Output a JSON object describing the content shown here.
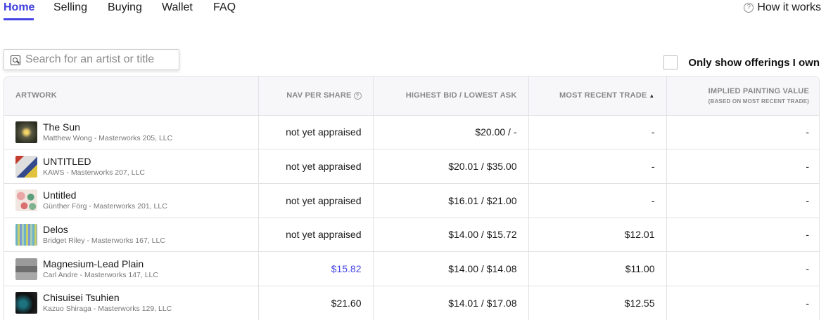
{
  "nav": {
    "tabs": [
      {
        "label": "Home",
        "active": true
      },
      {
        "label": "Selling",
        "active": false
      },
      {
        "label": "Buying",
        "active": false
      },
      {
        "label": "Wallet",
        "active": false
      },
      {
        "label": "FAQ",
        "active": false
      }
    ],
    "help_link": "How it works",
    "help_icon": "?"
  },
  "search": {
    "placeholder": "Search for an artist or title",
    "value": ""
  },
  "filter": {
    "only_show_label": "Only show offerings I own",
    "checked": false
  },
  "table": {
    "headers": {
      "artwork": "ARTWORK",
      "nav_per_share": "NAV PER SHARE",
      "nav_info_icon": "?",
      "bid_ask": "HIGHEST BID / LOWEST ASK",
      "most_recent_trade": "MOST RECENT TRADE",
      "sort_indicator": "▲",
      "implied_value": "IMPLIED PAINTING VALUE",
      "implied_value_sub": "(BASED ON MOST RECENT TRADE)"
    },
    "rows": [
      {
        "title": "The Sun",
        "subtitle": "Matthew Wong - Masterworks 205, LLC",
        "nav": "not yet appraised",
        "bid_ask": "$20.00 / -",
        "recent_trade": "-",
        "implied_value": "-"
      },
      {
        "title": "UNTITLED",
        "subtitle": "KAWS - Masterworks 207, LLC",
        "nav": "not yet appraised",
        "bid_ask": "$20.01 / $35.00",
        "recent_trade": "-",
        "implied_value": "-"
      },
      {
        "title": "Untitled",
        "subtitle": "Günther Förg - Masterworks 201, LLC",
        "nav": "not yet appraised",
        "bid_ask": "$16.01 / $21.00",
        "recent_trade": "-",
        "implied_value": "-"
      },
      {
        "title": "Delos",
        "subtitle": "Bridget Riley - Masterworks 167, LLC",
        "nav": "not yet appraised",
        "bid_ask": "$14.00 / $15.72",
        "recent_trade": "$12.01",
        "implied_value": "-"
      },
      {
        "title": "Magnesium-Lead Plain",
        "subtitle": "Carl Andre - Masterworks 147, LLC",
        "nav": "$15.82",
        "bid_ask": "$14.00 / $14.08",
        "recent_trade": "$11.00",
        "implied_value": "-"
      },
      {
        "title": "Chisuisei Tsuhien",
        "subtitle": "Kazuo Shiraga - Masterworks 129, LLC",
        "nav": "$21.60",
        "bid_ask": "$14.01 / $17.08",
        "recent_trade": "$12.55",
        "implied_value": "-"
      }
    ]
  },
  "colors": {
    "accent": "#4545e6",
    "header_bg": "#f7f7fa",
    "border": "#e2e2e6"
  }
}
